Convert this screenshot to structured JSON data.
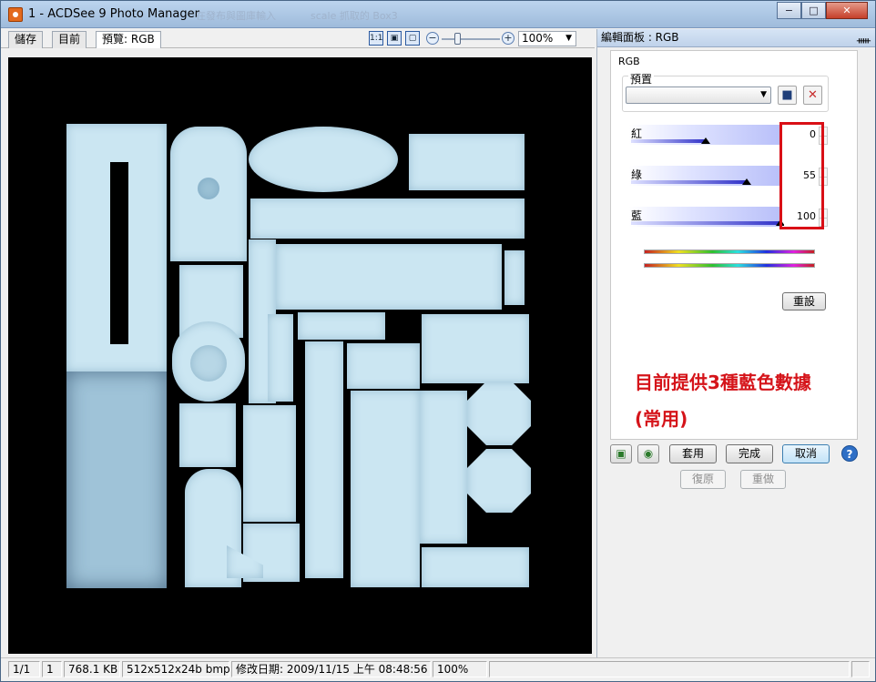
{
  "window": {
    "title": "1 - ACDSee 9 Photo Manager",
    "ghost_title_1": "在發布與圖庫輸入",
    "ghost_title_2": "scale 抓取的 Box3",
    "controls": {
      "minimize": "−",
      "maximize": "□",
      "close": "✕"
    }
  },
  "toolbar": {
    "tabs": [
      {
        "label": "儲存"
      },
      {
        "label": "目前"
      },
      {
        "label": "預覽: RGB"
      }
    ],
    "zoom_value": "100%",
    "zoom_minus": "−",
    "zoom_plus": "+",
    "icon_actual_size": "1:1",
    "icons": [
      "actual-size-icon",
      "fit-window-icon",
      "full-screen-icon"
    ]
  },
  "panel": {
    "title": "編輯面板 : RGB",
    "pin": "ᚔ",
    "section": "RGB",
    "preset_group_label": "預置",
    "preset_value": "",
    "sliders": [
      {
        "label": "紅",
        "value": "0",
        "fraction": 0.5
      },
      {
        "label": "綠",
        "value": "55",
        "fraction": 0.775
      },
      {
        "label": "藍",
        "value": "100",
        "fraction": 1.0
      }
    ],
    "reset_label": "重設",
    "annotation_line1": "目前提供3種藍色數據",
    "annotation_line2": "(常用)",
    "buttons": {
      "apply": "套用",
      "done": "完成",
      "cancel": "取消",
      "help": "?",
      "undo": "復原",
      "redo": "重做"
    }
  },
  "status": {
    "position": "1/1",
    "index": "1",
    "size": "768.1 KB",
    "dimensions": "512x512x24b bmp",
    "modified": "修改日期: 2009/11/15 上午 08:48:56",
    "zoom": "100%"
  },
  "colors": {
    "accent_red": "#d90f16",
    "texture_blue": "#cbe6f2"
  }
}
